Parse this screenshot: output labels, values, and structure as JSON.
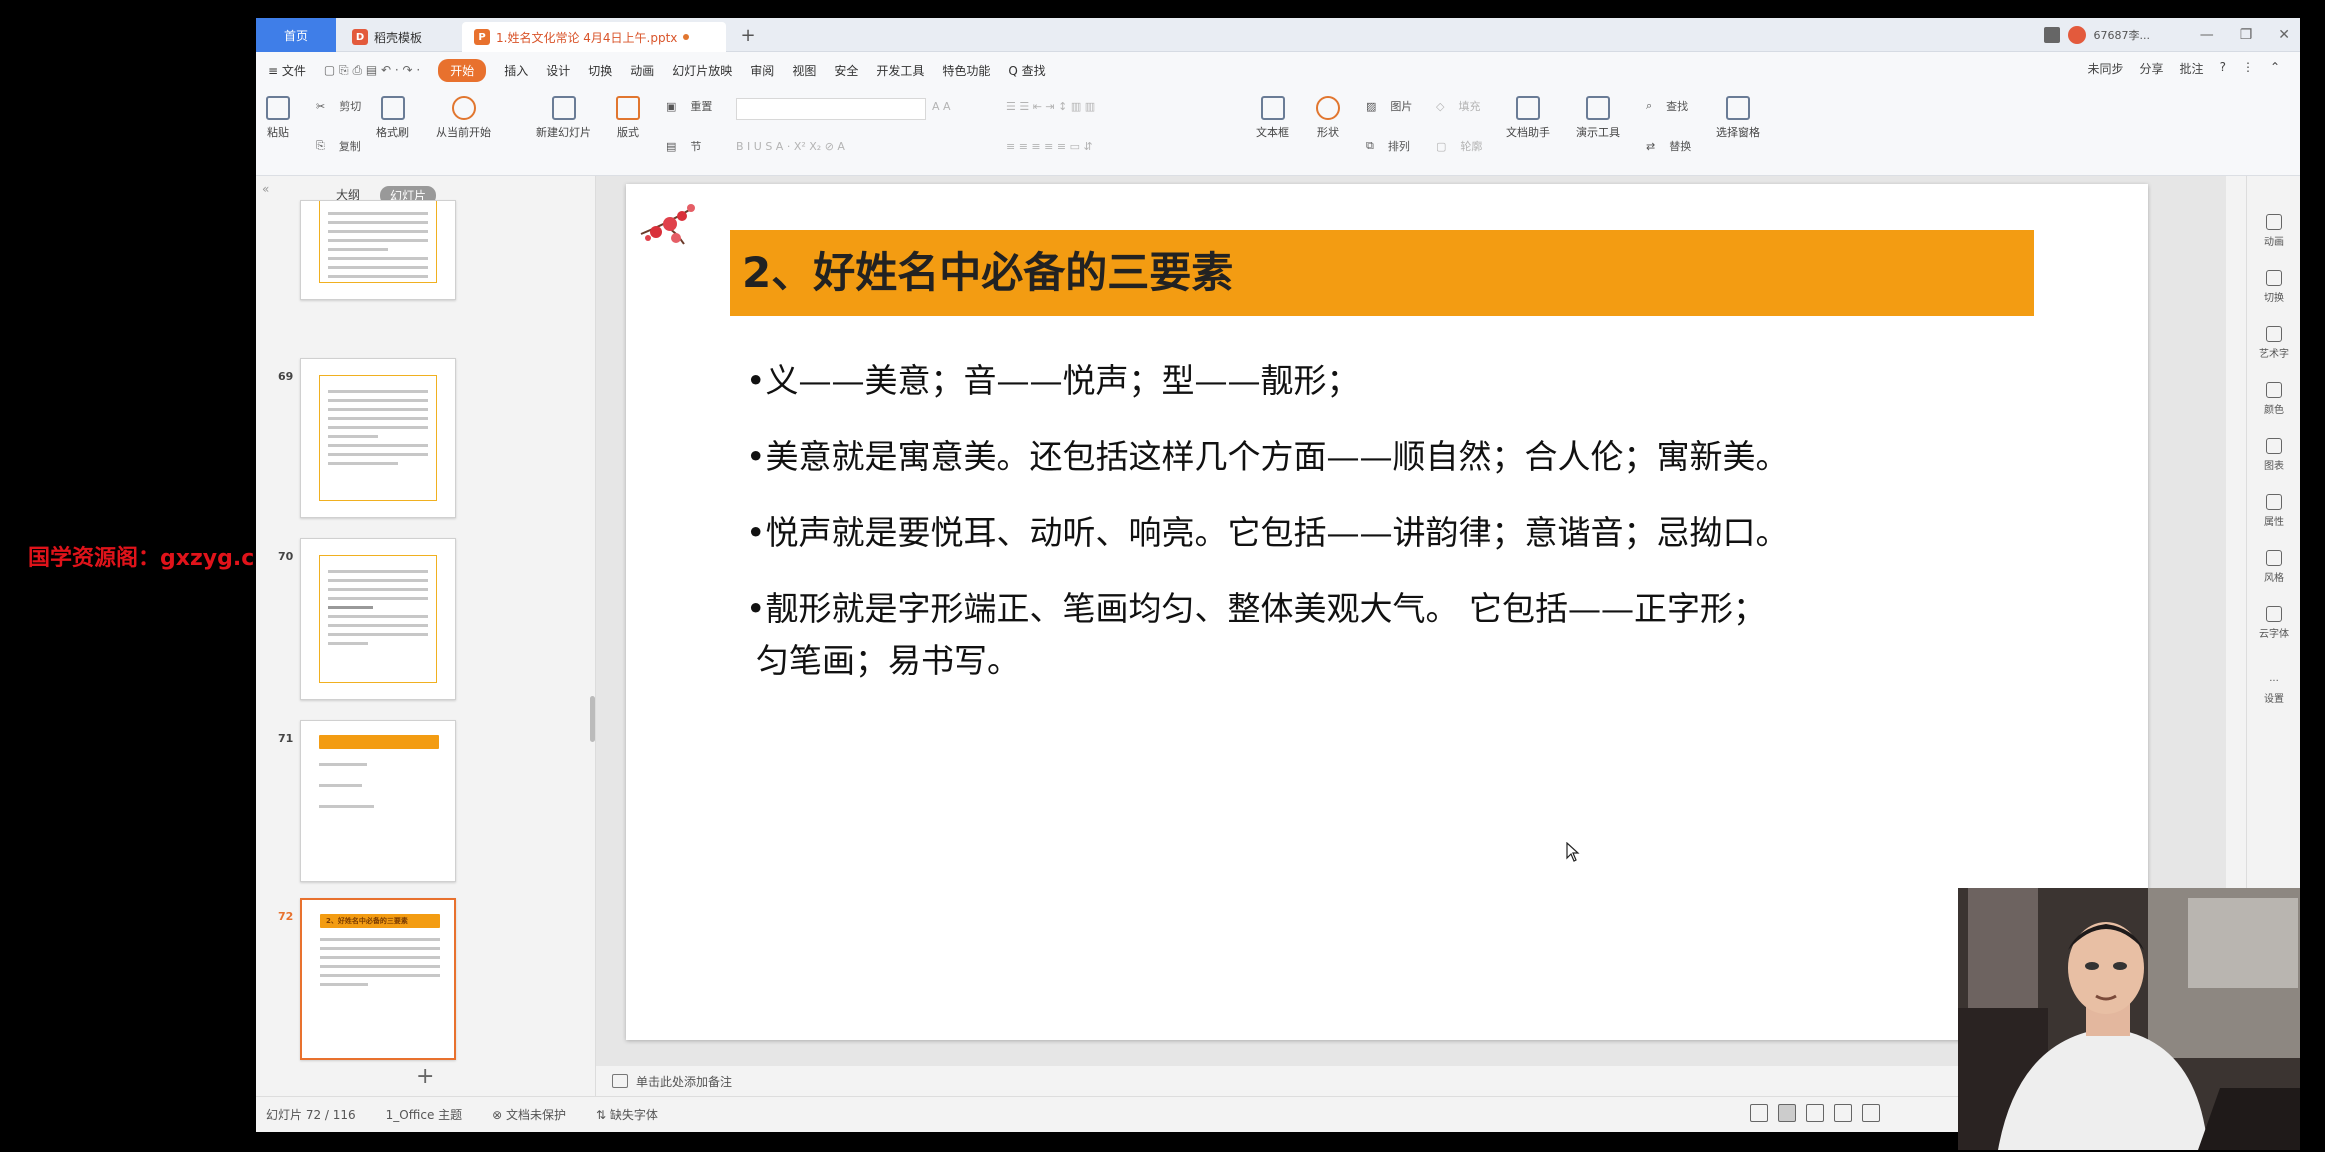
{
  "watermark": "国学资源阁：gxzyg.cn",
  "tabs": {
    "home": "首页",
    "template": "稻壳模板",
    "doc": "1.姓名文化常论 4月4日上午.pptx"
  },
  "user": {
    "name": "67687李..."
  },
  "menubar": {
    "file": "≡ 文件",
    "items": [
      "开始",
      "插入",
      "设计",
      "切换",
      "动画",
      "幻灯片放映",
      "审阅",
      "视图",
      "安全",
      "开发工具",
      "特色功能",
      "Q 查找"
    ],
    "right": [
      "未同步",
      "分享",
      "批注"
    ]
  },
  "ribbon": {
    "paste": "粘贴",
    "cut": "剪切",
    "copy": "复制",
    "format_painter": "格式刷",
    "from_current": "从当前开始",
    "new_slide": "新建幻灯片",
    "layout": "版式",
    "section": "节",
    "reset": "重置",
    "textbox": "文本框",
    "shape": "形状",
    "arrange": "排列",
    "picture": "图片",
    "fill": "填充",
    "outline": "轮廓",
    "doc_assistant": "文档助手",
    "presenter_tools": "演示工具",
    "find": "查找",
    "replace": "替换",
    "select_pane": "选择窗格"
  },
  "leftpanel": {
    "view_outline": "大纲",
    "view_slides": "幻灯片",
    "thumbs": [
      {
        "num": "",
        "title": ""
      },
      {
        "num": "69",
        "title": ""
      },
      {
        "num": "70",
        "title": ""
      },
      {
        "num": "71",
        "title": ""
      },
      {
        "num": "72",
        "title": "2、好姓名中必备的三要素"
      }
    ]
  },
  "slide": {
    "title": "2、好姓名中必备的三要素",
    "bullets": [
      "•义——美意；音——悦声；型——靓形；",
      "•美意就是寓意美。还包括这样几个方面——顺自然；合人伦；寓新美。",
      "•悦声就是要悦耳、动听、响亮。它包括——讲韵律；意谐音；忌拗口。",
      "•靓形就是字形端正、笔画均匀、整体美观大气。 它包括——正字形；",
      "匀笔画；易书写。"
    ],
    "colors": {
      "title_bar": "#f39c12",
      "accent": "#e8712e"
    }
  },
  "notes": {
    "placeholder": "单击此处添加备注"
  },
  "status": {
    "slide_count": "幻灯片 72 / 116",
    "theme": "1_Office 主题",
    "protect": "文档未保护",
    "font": "缺失字体"
  },
  "rightbar": [
    "动画",
    "切换",
    "艺术字",
    "颜色",
    "图表",
    "属性",
    "风格",
    "云字体",
    "设置"
  ]
}
